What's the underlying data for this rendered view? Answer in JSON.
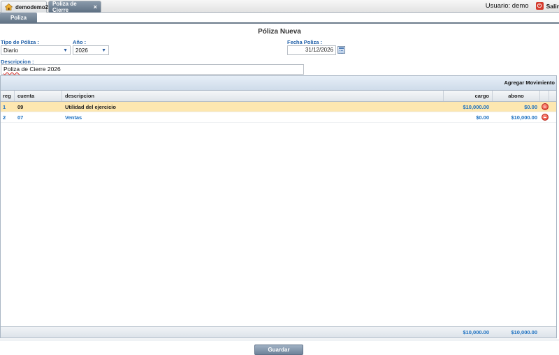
{
  "tabs": [
    {
      "label": "demodemo2",
      "icon": "home-icon"
    },
    {
      "label": "Poliza de Cierre",
      "close": "×"
    }
  ],
  "user": {
    "label": "Usuario: demo",
    "exit_label": "Salir",
    "exit_icon": "exit-icon"
  },
  "subtab": {
    "label": "Poliza"
  },
  "form": {
    "title": "Póliza Nueva",
    "tipo_label": "Tipo de Póliza :",
    "tipo_value": "Diario",
    "anio_label": "Año :",
    "anio_value": "2026",
    "fecha_label": "Fecha Poliza :",
    "fecha_value": "31/12/2026",
    "descripcion_label": "Descripcion :",
    "descripcion_word1": "Poliza",
    "descripcion_rest": " de Cierre 2026"
  },
  "grid": {
    "add_label": "Agregar Movimiento",
    "columns": [
      "reg",
      "cuenta",
      "descripcion",
      "cargo",
      "abono"
    ],
    "rows": [
      {
        "reg": "1",
        "cuenta": "09",
        "descripcion": "Utilidad del ejercicio",
        "cargo": "$10,000.00",
        "abono": "$0.00"
      },
      {
        "reg": "2",
        "cuenta": "07",
        "descripcion": "Ventas",
        "cargo": "$0.00",
        "abono": "$10,000.00"
      }
    ],
    "total_cargo": "$10,000.00",
    "total_abono": "$10,000.00"
  },
  "save_label": "Guardar"
}
